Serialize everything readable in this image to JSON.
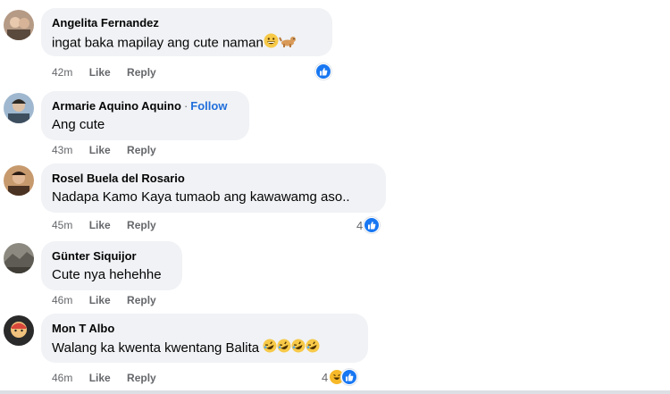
{
  "comments": [
    {
      "name": "Angelita Fernandez",
      "text": "ingat baka mapilay ang cute naman",
      "time": "42m",
      "like_label": "Like",
      "reply_label": "Reply",
      "reaction_count": "",
      "reaction_icons": [
        "like-icon"
      ],
      "text_emojis": [
        "grinning-face-emoji",
        "dog-emoji"
      ],
      "avatar_colors": [
        "#b59a85",
        "#5a4a3d"
      ]
    },
    {
      "name": "Armarie Aquino Aquino",
      "follow_label": "Follow",
      "text": "Ang cute",
      "time": "43m",
      "like_label": "Like",
      "reply_label": "Reply",
      "avatar_colors": [
        "#9fb8cf",
        "#3d4e5f"
      ]
    },
    {
      "name": "Rosel Buela del Rosario",
      "text": "Nadapa Kamo Kaya tumaob ang kawawamg aso..",
      "time": "45m",
      "like_label": "Like",
      "reply_label": "Reply",
      "reaction_count": "4",
      "reaction_icons": [
        "like-icon"
      ],
      "avatar_colors": [
        "#c79a6e",
        "#4b3323"
      ]
    },
    {
      "name": "Günter Siquijor",
      "text": "Cute nya hehehhe",
      "time": "46m",
      "like_label": "Like",
      "reply_label": "Reply",
      "avatar_colors": [
        "#8c8a80",
        "#3f3d36"
      ]
    },
    {
      "name": "Mon T Albo",
      "text": "Walang ka kwenta kwentang Balita",
      "time": "46m",
      "like_label": "Like",
      "reply_label": "Reply",
      "reaction_count": "4",
      "reaction_icons": [
        "haha-icon",
        "like-icon"
      ],
      "text_emojis": [
        "rofl-emoji",
        "rofl-emoji",
        "rofl-emoji",
        "rofl-emoji"
      ],
      "avatar_colors": [
        "#d9473b",
        "#2a2a2a"
      ]
    }
  ],
  "colors": {
    "bubble_bg": "#f0f2f5",
    "secondary_text": "#65676b",
    "follow_blue": "#216fdb",
    "like_blue": "#1877f2",
    "haha_yellow": "#f7b928"
  }
}
